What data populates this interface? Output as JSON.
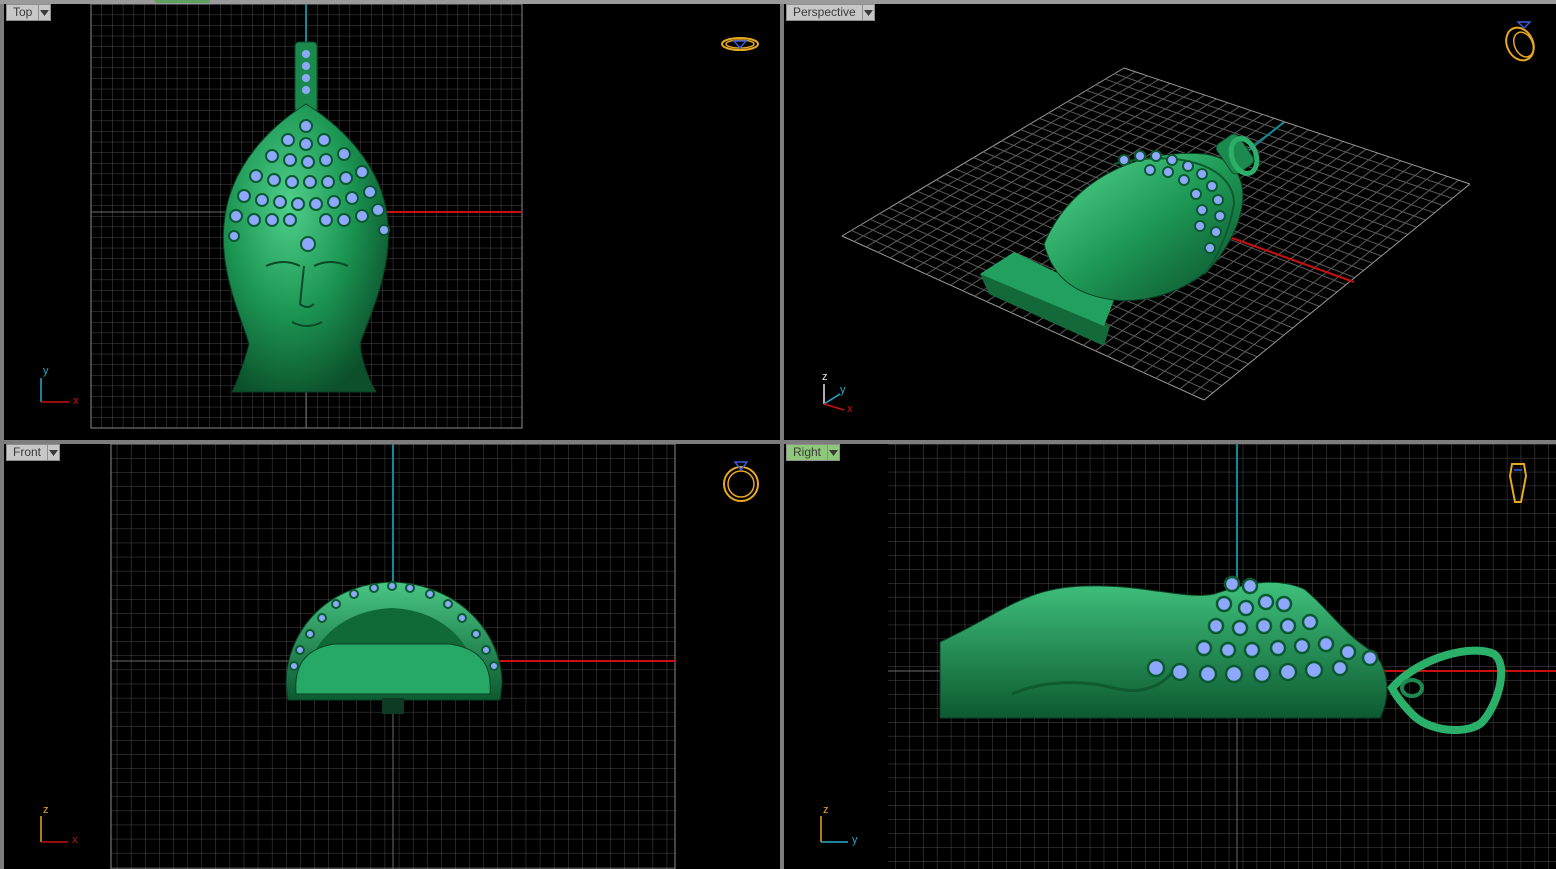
{
  "viewports": {
    "top": {
      "label": "Top",
      "axis_a": "y",
      "axis_b": "x",
      "gizmo": "ring-top-icon"
    },
    "perspective": {
      "label": "Perspective",
      "axis_a": "z",
      "axis_b": "y",
      "axis_c": "x",
      "gizmo": "ring-perspective-icon"
    },
    "front": {
      "label": "Front",
      "axis_a": "z",
      "axis_b": "x",
      "gizmo": "ring-front-icon"
    },
    "right": {
      "label": "Right",
      "axis_a": "z",
      "axis_b": "y",
      "gizmo": "ring-side-icon",
      "active": true
    }
  },
  "colors": {
    "background": "#000000",
    "grid": "#5a5a5a",
    "model": "#1f9a5a",
    "gem": "#8fa8ff",
    "x_axis": "#c81010",
    "vertical_axis": "#108a9a",
    "gizmo": "#e8a820",
    "active_label": "#8fc87a"
  }
}
